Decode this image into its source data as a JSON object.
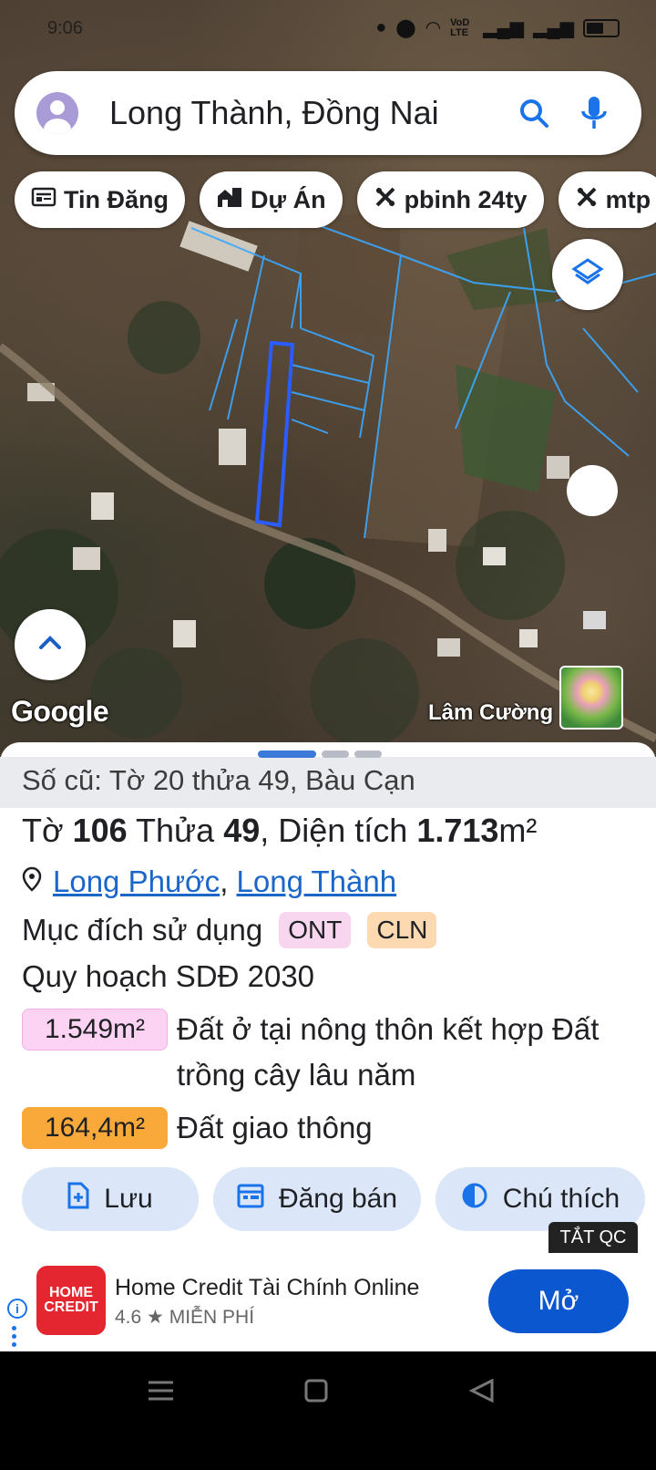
{
  "status_bar": {
    "time": "9:06",
    "net_label": "VoD LTE"
  },
  "search": {
    "query": "Long Thành, Đồng Nai"
  },
  "chips": [
    {
      "icon": "newspaper-icon",
      "label": "Tin Đăng"
    },
    {
      "icon": "building-icon",
      "label": "Dự Án"
    },
    {
      "icon": "ruler-icon",
      "label": "pbinh 24ty"
    },
    {
      "icon": "ruler-icon",
      "label": "mtp"
    }
  ],
  "map": {
    "google_logo": "Google",
    "owner_name": "Lâm Cường",
    "highlight_color": "#2a5cff",
    "boundary_color": "#3aa8ff"
  },
  "sheet": {
    "old_parcel": "Số cũ: Tờ 20 thửa 49, Bàu Cạn",
    "title": {
      "sheet_prefix": "Tờ ",
      "sheet_no": "106",
      "parcel_prefix": " Thửa ",
      "parcel_no": "49",
      "area_prefix": ", Diện tích ",
      "area": "1.713",
      "area_unit": "m²"
    },
    "ward": "Long Phước",
    "separator": ",",
    "district": "Long Thành",
    "purpose_label": "Mục đích sử dụng",
    "purpose_tags": [
      {
        "code": "ONT",
        "color": "#f8d6f0"
      },
      {
        "code": "CLN",
        "color": "#fcd9b0"
      }
    ],
    "plan_label": "Quy hoạch SDĐ 2030",
    "zones": [
      {
        "area": "1.549m²",
        "desc": "Đất ở tại nông thôn kết hợp Đất trồng cây lâu năm",
        "color": "#fdd3f3"
      },
      {
        "area": "164,4m²",
        "desc": "Đất giao thông",
        "color": "#f8a93a"
      }
    ],
    "actions": {
      "save": "Lưu",
      "sell": "Đăng bán",
      "legend": "Chú thích"
    }
  },
  "ad": {
    "close_label": "TẮT QC",
    "logo_text_1": "HOME",
    "logo_text_2": "CREDIT",
    "title": "Home Credit Tài Chính Online",
    "rating": "4.6",
    "price": "MIỄN PHÍ",
    "open_label": "Mở"
  }
}
